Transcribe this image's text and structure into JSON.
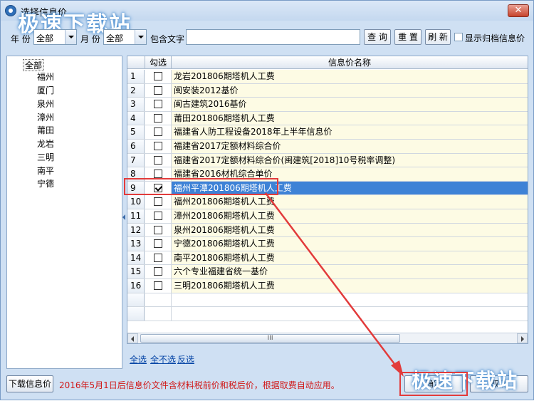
{
  "window": {
    "title": "选择信息价",
    "close_glyph": "✕",
    "watermark_text": "极速下载站"
  },
  "filters": {
    "year_label": "年 份",
    "year_value": "全部",
    "month_label": "月 份",
    "month_value": "全部",
    "contains_label": "包含文字",
    "contains_value": "",
    "query_button": "查 询",
    "reset_button": "重 置",
    "refresh_button": "刷 新",
    "show_archived_label": "显示归档信息价",
    "show_archived_checked": false
  },
  "tree": {
    "root": "全部",
    "items": [
      "福州",
      "厦门",
      "泉州",
      "漳州",
      "莆田",
      "龙岩",
      "三明",
      "南平",
      "宁德"
    ]
  },
  "grid": {
    "columns": {
      "check": "勾选",
      "name": "信息价名称"
    },
    "rows": [
      {
        "num": "1",
        "checked": false,
        "name": "龙岩201806期塔机人工费"
      },
      {
        "num": "2",
        "checked": false,
        "name": "闽安装2012基价"
      },
      {
        "num": "3",
        "checked": false,
        "name": "闽古建筑2016基价"
      },
      {
        "num": "4",
        "checked": false,
        "name": "莆田201806期塔机人工费"
      },
      {
        "num": "5",
        "checked": false,
        "name": "福建省人防工程设备2018年上半年信息价"
      },
      {
        "num": "6",
        "checked": false,
        "name": "福建省2017定额材料综合价"
      },
      {
        "num": "7",
        "checked": false,
        "name": "福建省2017定额材料综合价(闽建筑[2018]10号税率调整)"
      },
      {
        "num": "8",
        "checked": false,
        "name": "福建省2016材机综合单价"
      },
      {
        "num": "9",
        "checked": true,
        "name": "福州平潭201806期塔机人工费"
      },
      {
        "num": "10",
        "checked": false,
        "name": "福州201806期塔机人工费"
      },
      {
        "num": "11",
        "checked": false,
        "name": "漳州201806期塔机人工费"
      },
      {
        "num": "12",
        "checked": false,
        "name": "泉州201806期塔机人工费"
      },
      {
        "num": "13",
        "checked": false,
        "name": "宁德201806期塔机人工费"
      },
      {
        "num": "14",
        "checked": false,
        "name": "南平201806期塔机人工费"
      },
      {
        "num": "15",
        "checked": false,
        "name": "六个专业福建省统一基价"
      },
      {
        "num": "16",
        "checked": false,
        "name": "三明201806期塔机人工费"
      }
    ],
    "selected_row": "9",
    "scroll_thumb_grip": "III"
  },
  "links": {
    "select_all": "全选",
    "select_none": "全不选",
    "invert": "反选"
  },
  "footer": {
    "download_button": "下载信息价",
    "notice": "2016年5月1日后信息价文件含材料税前价和税后价，根据取费自动应用。",
    "confirm_button": "确定",
    "cancel_button": "取消"
  },
  "colors": {
    "titlebar": "#cfe0f3",
    "selected_row": "#3e82d6",
    "row_background": "#fdfbe4",
    "notice_text": "#d01818",
    "annotation": "#e23b3b"
  }
}
